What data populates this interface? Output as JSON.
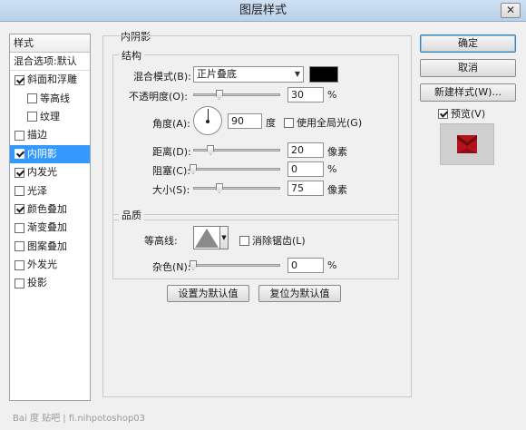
{
  "window": {
    "title": "图层样式",
    "close_glyph": "✕"
  },
  "stylelist": {
    "header": "样式",
    "blending_options": "混合选项:默认",
    "items": [
      {
        "label": "斜面和浮雕",
        "checked": true
      },
      {
        "label": "等高线",
        "checked": false
      },
      {
        "label": "纹理",
        "checked": false
      },
      {
        "label": "描边",
        "checked": false
      },
      {
        "label": "内阴影",
        "checked": true,
        "selected": true
      },
      {
        "label": "内发光",
        "checked": true
      },
      {
        "label": "光泽",
        "checked": false
      },
      {
        "label": "颜色叠加",
        "checked": true
      },
      {
        "label": "渐变叠加",
        "checked": false
      },
      {
        "label": "图案叠加",
        "checked": false
      },
      {
        "label": "外发光",
        "checked": false
      },
      {
        "label": "投影",
        "checked": false
      }
    ]
  },
  "panel": {
    "title": "内阴影",
    "structure": {
      "title": "结构",
      "blend_mode_label": "混合模式(B):",
      "blend_mode_value": "正片叠底",
      "blend_color": "#000000",
      "opacity_label": "不透明度(O):",
      "opacity_value": "30",
      "opacity_unit": "%",
      "opacity_fraction": 0.3,
      "angle_label": "角度(A):",
      "angle_value": "90",
      "angle_unit": "度",
      "global_light_label": "使用全局光(G)",
      "global_light_checked": false,
      "distance_label": "距离(D):",
      "distance_value": "20",
      "distance_unit": "像素",
      "distance_fraction": 0.2,
      "choke_label": "阻塞(C):",
      "choke_value": "0",
      "choke_unit": "%",
      "choke_fraction": 0.0,
      "size_label": "大小(S):",
      "size_value": "75",
      "size_unit": "像素",
      "size_fraction": 0.3
    },
    "quality": {
      "title": "品质",
      "contour_label": "等高线:",
      "anti_alias_label": "消除锯齿(L)",
      "anti_alias_checked": false,
      "noise_label": "杂色(N):",
      "noise_value": "0",
      "noise_unit": "%",
      "noise_fraction": 0.0
    },
    "make_default": "设置为默认值",
    "reset_default": "复位为默认值"
  },
  "buttons": {
    "ok": "确定",
    "cancel": "取消",
    "new_style": "新建样式(W)...",
    "preview_label": "预览(V)",
    "preview_checked": true
  },
  "watermark": "Bai 度 贴吧  |  fi.nihpotoshop03",
  "colors": {
    "selection": "#3399ff",
    "preview_red": "#b3131a",
    "preview_bg": "#cfcfcf"
  }
}
